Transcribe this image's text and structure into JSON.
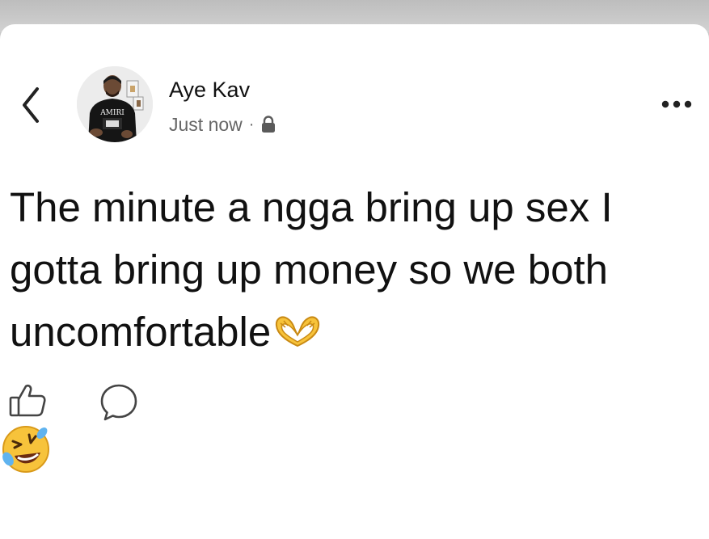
{
  "post": {
    "author_name": "Aye Kav",
    "timestamp": "Just now",
    "separator": "·",
    "privacy_icon": "lock-icon",
    "text": "The minute a ngga bring up sex I gotta bring up money so we both uncomfortable",
    "trailing_emoji": "heart-hands-emoji",
    "avatar_shirt_text": "AMIRI"
  },
  "actions": {
    "back_icon": "chevron-left-icon",
    "more_icon": "more-options-icon",
    "like_icon": "thumbs-up-icon",
    "comment_icon": "comment-bubble-icon",
    "reaction_icon": "rolling-on-floor-laughing-emoji"
  },
  "colors": {
    "text": "#111111",
    "meta_text": "#666666",
    "background": "#ffffff",
    "emoji_yellow": "#f7c33b"
  }
}
